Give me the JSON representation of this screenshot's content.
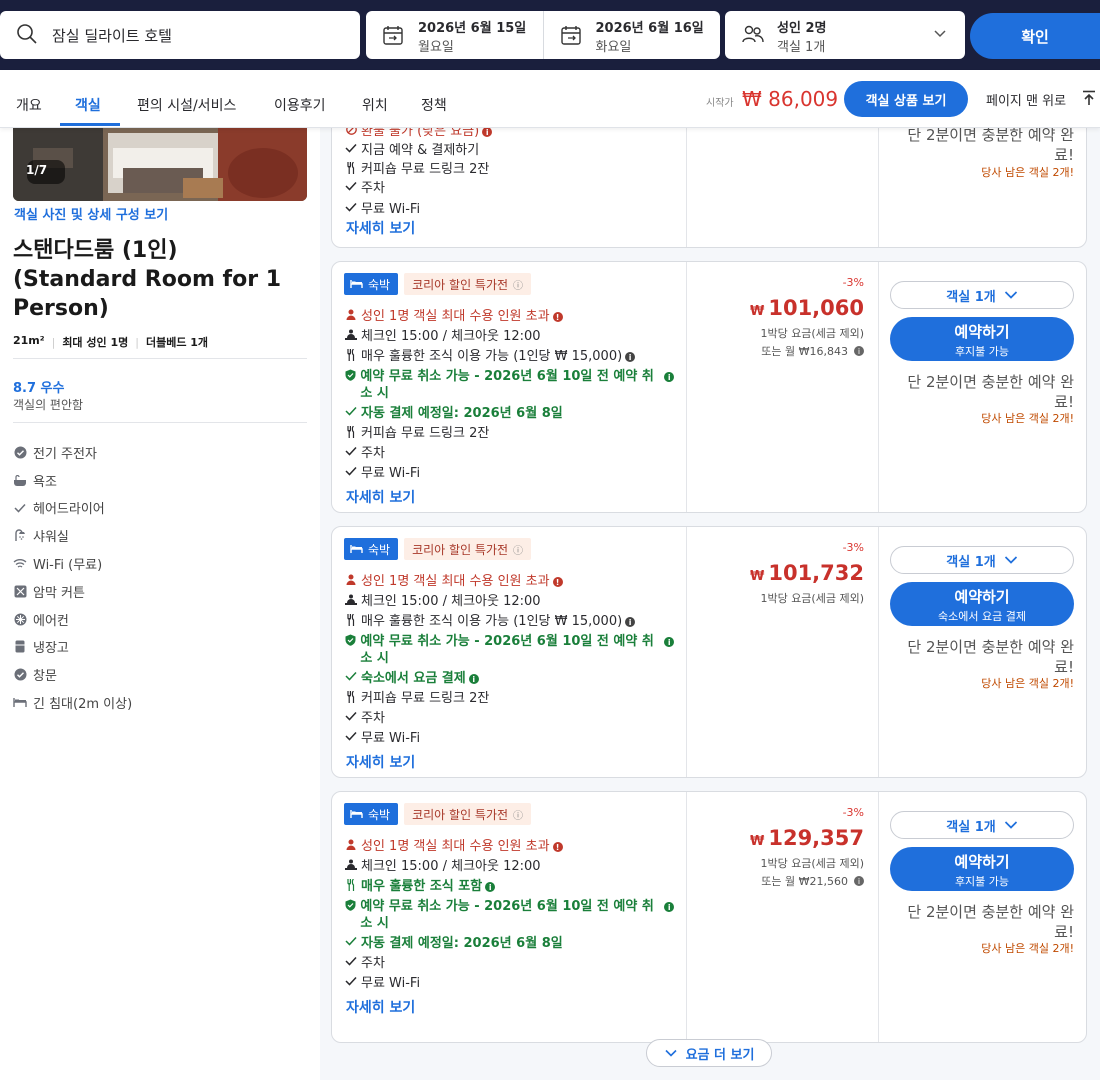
{
  "search": {
    "query": "잠실 딜라이트 호텔",
    "checkin_date": "2026년 6월 15일",
    "checkin_day": "월요일",
    "checkout_date": "2026년 6월 16일",
    "checkout_day": "화요일",
    "guests": "성인 2명",
    "rooms": "객실 1개",
    "confirm_label": "확인"
  },
  "tabs": [
    {
      "label": "개요",
      "active": false
    },
    {
      "label": "객실",
      "active": true
    },
    {
      "label": "편의 시설/서비스",
      "active": false
    },
    {
      "label": "이용후기",
      "active": false
    },
    {
      "label": "위치",
      "active": false
    },
    {
      "label": "정책",
      "active": false
    }
  ],
  "header_price": {
    "prefix": "시작가",
    "value": "₩ 86,009",
    "view_rooms_label": "객실 상품 보기",
    "to_top_label": "페이지 맨 위로"
  },
  "room": {
    "image_counter": "1/7",
    "photos_link": "객실 사진 및 상세 구성 보기",
    "title": "스탠다드룸 (1인) (Standard Room for 1 Person)",
    "specs": [
      "21m²",
      "최대 성인 1명",
      "더블베드 1개"
    ],
    "rating_score": "8.7 우수",
    "rating_label": "객실의 편안함",
    "amenities": [
      {
        "icon": "check-circle-icon",
        "label": "전기 주전자"
      },
      {
        "icon": "bathtub-icon",
        "label": "욕조"
      },
      {
        "icon": "check-icon",
        "label": "헤어드라이어"
      },
      {
        "icon": "shower-icon",
        "label": "샤워실"
      },
      {
        "icon": "wifi-icon",
        "label": "Wi-Fi (무료)"
      },
      {
        "icon": "blackout-icon",
        "label": "암막 커튼"
      },
      {
        "icon": "aircon-icon",
        "label": "에어컨"
      },
      {
        "icon": "fridge-icon",
        "label": "냉장고"
      },
      {
        "icon": "check-circle-icon",
        "label": "창문"
      },
      {
        "icon": "bed-icon",
        "label": "긴 침대(2m 이상)"
      }
    ]
  },
  "partial_card": {
    "features": [
      {
        "icon": "cancel-icon",
        "text": "환불 불가 (낮은 요금)",
        "style": "red"
      },
      {
        "icon": "check-icon",
        "text": "지금 예약 & 결제하기",
        "style": "dark"
      },
      {
        "icon": "cutlery-icon",
        "text": "커피숍 무료 드링크 2잔",
        "style": "dark"
      },
      {
        "icon": "check-icon",
        "text": "주차",
        "style": "dark"
      },
      {
        "icon": "check-icon",
        "text": "무료 Wi-Fi",
        "style": "dark"
      }
    ],
    "more_link": "자세히 보기",
    "urgency": "단 2분이면 충분한 예약 완료!",
    "left_rooms": "당사 남은 객실 2개!"
  },
  "offers": [
    {
      "badge_stay": "숙박",
      "badge_promo": "코리아 할인 특가전",
      "features": [
        {
          "icon": "person-icon",
          "text": "성인 1명 객실 최대 수용 인원 초과",
          "style": "red",
          "info": true
        },
        {
          "icon": "checkin-icon",
          "text": "체크인 15:00 / 체크아웃 12:00",
          "style": "dark",
          "info": false
        },
        {
          "icon": "cutlery-icon",
          "text": "매우 훌륭한 조식 이용 가능 (1인당 ₩ 15,000)",
          "style": "dark",
          "info": true
        },
        {
          "icon": "shield-icon",
          "text": "예약 무료 취소 가능 - 2026년 6월 10일 전 예약 취소 시",
          "style": "green",
          "info": true
        },
        {
          "icon": "check-icon",
          "text": "자동 결제 예정일: 2026년 6월 8일",
          "style": "green",
          "info": false
        },
        {
          "icon": "cutlery-icon",
          "text": "커피숍 무료 드링크 2잔",
          "style": "dark",
          "info": false
        },
        {
          "icon": "check-icon",
          "text": "주차",
          "style": "dark",
          "info": false
        },
        {
          "icon": "check-icon",
          "text": "무료 Wi-Fi",
          "style": "dark",
          "info": false
        }
      ],
      "more_link": "자세히 보기",
      "discount": "-3%",
      "price": "101,060",
      "per_night": "1박당 요금(세금 제외)",
      "monthly": "또는 월 ₩16,843",
      "room_select": "객실 1개",
      "book_label": "예약하기",
      "book_sub": "후지불 가능",
      "urgency": "단 2분이면 충분한 예약 완료!",
      "left_rooms": "당사 남은 객실 2개!"
    },
    {
      "badge_stay": "숙박",
      "badge_promo": "코리아 할인 특가전",
      "features": [
        {
          "icon": "person-icon",
          "text": "성인 1명 객실 최대 수용 인원 초과",
          "style": "red",
          "info": true
        },
        {
          "icon": "checkin-icon",
          "text": "체크인 15:00 / 체크아웃 12:00",
          "style": "dark",
          "info": false
        },
        {
          "icon": "cutlery-icon",
          "text": "매우 훌륭한 조식 이용 가능 (1인당 ₩ 15,000)",
          "style": "dark",
          "info": true
        },
        {
          "icon": "shield-icon",
          "text": "예약 무료 취소 가능 - 2026년 6월 10일 전 예약 취소 시",
          "style": "green",
          "info": true
        },
        {
          "icon": "check-icon",
          "text": "숙소에서 요금 결제",
          "style": "green",
          "info": true
        },
        {
          "icon": "cutlery-icon",
          "text": "커피숍 무료 드링크 2잔",
          "style": "dark",
          "info": false
        },
        {
          "icon": "check-icon",
          "text": "주차",
          "style": "dark",
          "info": false
        },
        {
          "icon": "check-icon",
          "text": "무료 Wi-Fi",
          "style": "dark",
          "info": false
        }
      ],
      "more_link": "자세히 보기",
      "discount": "-3%",
      "price": "101,732",
      "per_night": "1박당 요금(세금 제외)",
      "monthly": "",
      "room_select": "객실 1개",
      "book_label": "예약하기",
      "book_sub": "숙소에서 요금 결제",
      "urgency": "단 2분이면 충분한 예약 완료!",
      "left_rooms": "당사 남은 객실 2개!"
    },
    {
      "badge_stay": "숙박",
      "badge_promo": "코리아 할인 특가전",
      "features": [
        {
          "icon": "person-icon",
          "text": "성인 1명 객실 최대 수용 인원 초과",
          "style": "red",
          "info": true
        },
        {
          "icon": "checkin-icon",
          "text": "체크인 15:00 / 체크아웃 12:00",
          "style": "dark",
          "info": false
        },
        {
          "icon": "cutlery-icon",
          "text": "매우 훌륭한 조식 포함",
          "style": "green",
          "info": true
        },
        {
          "icon": "shield-icon",
          "text": "예약 무료 취소 가능 - 2026년 6월 10일 전 예약 취소 시",
          "style": "green",
          "info": true
        },
        {
          "icon": "check-icon",
          "text": "자동 결제 예정일: 2026년 6월 8일",
          "style": "green",
          "info": false
        },
        {
          "icon": "check-icon",
          "text": "주차",
          "style": "dark",
          "info": false
        },
        {
          "icon": "check-icon",
          "text": "무료 Wi-Fi",
          "style": "dark",
          "info": false
        }
      ],
      "more_link": "자세히 보기",
      "discount": "-3%",
      "price": "129,357",
      "per_night": "1박당 요금(세금 제외)",
      "monthly": "또는 월 ₩21,560",
      "room_select": "객실 1개",
      "book_label": "예약하기",
      "book_sub": "후지불 가능",
      "urgency": "단 2분이면 충분한 예약 완료!",
      "left_rooms": "당사 남은 객실 2개!"
    }
  ],
  "currency_symbol": "₩",
  "more_rates_label": "요금 더 보기",
  "colors": {
    "brand": "#1f6fdc",
    "header_bg": "#1a1f3d",
    "price_red": "#c8312b",
    "green": "#1a7f3a"
  }
}
